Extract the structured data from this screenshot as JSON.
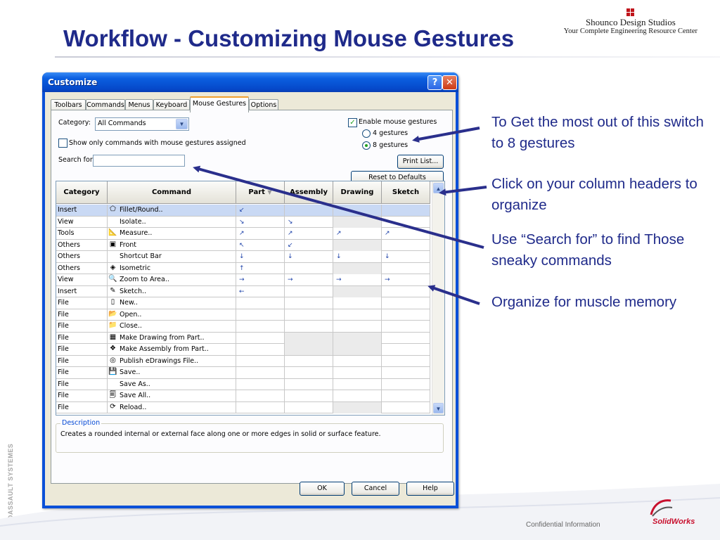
{
  "slide": {
    "title": "Workflow - Customizing Mouse Gestures",
    "brand_name": "Shounco Design Studios",
    "brand_tagline": "Your Complete Engineering Resource Center",
    "side_mark": "© DASSAULT SYSTEMES",
    "confidential": "Confidential Information",
    "solidworks_logo": "SolidWorks"
  },
  "dialog": {
    "title": "Customize",
    "help_button": "?",
    "close_button": "✕",
    "tabs": [
      "Toolbars",
      "Commands",
      "Menus",
      "Keyboard",
      "Mouse Gestures",
      "Options"
    ],
    "active_tab": "Mouse Gestures",
    "category_label": "Category:",
    "category_value": "All Commands",
    "show_only_label": "Show only commands with mouse gestures assigned",
    "search_label": "Search for:",
    "search_value": "",
    "enable_label": "Enable mouse gestures",
    "enable_checked": true,
    "radio_4": "4 gestures",
    "radio_8": "8 gestures",
    "selected_gestures": "8 gestures",
    "print_list": "Print List...",
    "reset": "Reset to Defaults",
    "columns": [
      "Category",
      "Command",
      "Part",
      "Assembly",
      "Drawing",
      "Sketch"
    ],
    "rows": [
      {
        "category": "Insert",
        "icon": "fillet-icon",
        "command": "Fillet/Round..",
        "part": "↙",
        "assembly": "",
        "drawing": "",
        "sketch": ""
      },
      {
        "category": "View",
        "icon": "",
        "command": "Isolate..",
        "part": "↘",
        "assembly": "↘",
        "drawing": "",
        "sketch": ""
      },
      {
        "category": "Tools",
        "icon": "measure-icon",
        "command": "Measure..",
        "part": "↗",
        "assembly": "↗",
        "drawing": "↗",
        "sketch": "↗"
      },
      {
        "category": "Others",
        "icon": "front-view-icon",
        "command": "Front",
        "part": "↖",
        "assembly": "↙",
        "drawing": "",
        "sketch": ""
      },
      {
        "category": "Others",
        "icon": "",
        "command": "Shortcut Bar",
        "part": "↓",
        "assembly": "↓",
        "drawing": "↓",
        "sketch": "↓"
      },
      {
        "category": "Others",
        "icon": "isometric-icon",
        "command": "Isometric",
        "part": "↑",
        "assembly": "",
        "drawing": "",
        "sketch": ""
      },
      {
        "category": "View",
        "icon": "zoom-area-icon",
        "command": "Zoom to Area..",
        "part": "→",
        "assembly": "→",
        "drawing": "→",
        "sketch": "→"
      },
      {
        "category": "Insert",
        "icon": "sketch-icon",
        "command": "Sketch..",
        "part": "←",
        "assembly": "",
        "drawing": "",
        "sketch": ""
      },
      {
        "category": "File",
        "icon": "new-file-icon",
        "command": "New..",
        "part": "",
        "assembly": "",
        "drawing": "",
        "sketch": ""
      },
      {
        "category": "File",
        "icon": "open-folder-icon",
        "command": "Open..",
        "part": "",
        "assembly": "",
        "drawing": "",
        "sketch": ""
      },
      {
        "category": "File",
        "icon": "close-folder-icon",
        "command": "Close..",
        "part": "",
        "assembly": "",
        "drawing": "",
        "sketch": ""
      },
      {
        "category": "File",
        "icon": "make-drawing-icon",
        "command": "Make Drawing from Part..",
        "part": "",
        "assembly": "",
        "drawing": "",
        "sketch": ""
      },
      {
        "category": "File",
        "icon": "make-assembly-icon",
        "command": "Make Assembly from Part..",
        "part": "",
        "assembly": "",
        "drawing": "",
        "sketch": ""
      },
      {
        "category": "File",
        "icon": "edrawings-icon",
        "command": "Publish eDrawings File..",
        "part": "",
        "assembly": "",
        "drawing": "",
        "sketch": ""
      },
      {
        "category": "File",
        "icon": "save-icon",
        "command": "Save..",
        "part": "",
        "assembly": "",
        "drawing": "",
        "sketch": ""
      },
      {
        "category": "File",
        "icon": "",
        "command": "Save As..",
        "part": "",
        "assembly": "",
        "drawing": "",
        "sketch": ""
      },
      {
        "category": "File",
        "icon": "save-all-icon",
        "command": "Save All..",
        "part": "",
        "assembly": "",
        "drawing": "",
        "sketch": ""
      },
      {
        "category": "File",
        "icon": "reload-icon",
        "command": "Reload..",
        "part": "",
        "assembly": "",
        "drawing": "",
        "sketch": ""
      }
    ],
    "description_legend": "Description",
    "description_text": "Creates a rounded internal or external face along one or more edges in solid or surface feature.",
    "ok": "OK",
    "cancel": "Cancel",
    "help": "Help"
  },
  "annotations": [
    "To Get the most out of this switch to 8 gestures",
    "Click on your column headers to organize",
    "Use “Search for” to find Those sneaky commands",
    "Organize for muscle memory"
  ],
  "colors": {
    "title": "#1f2a8a",
    "arrow": "#2a2f8c",
    "xp_titlebar": "#0548c9",
    "selection": "#c9d9f4"
  }
}
